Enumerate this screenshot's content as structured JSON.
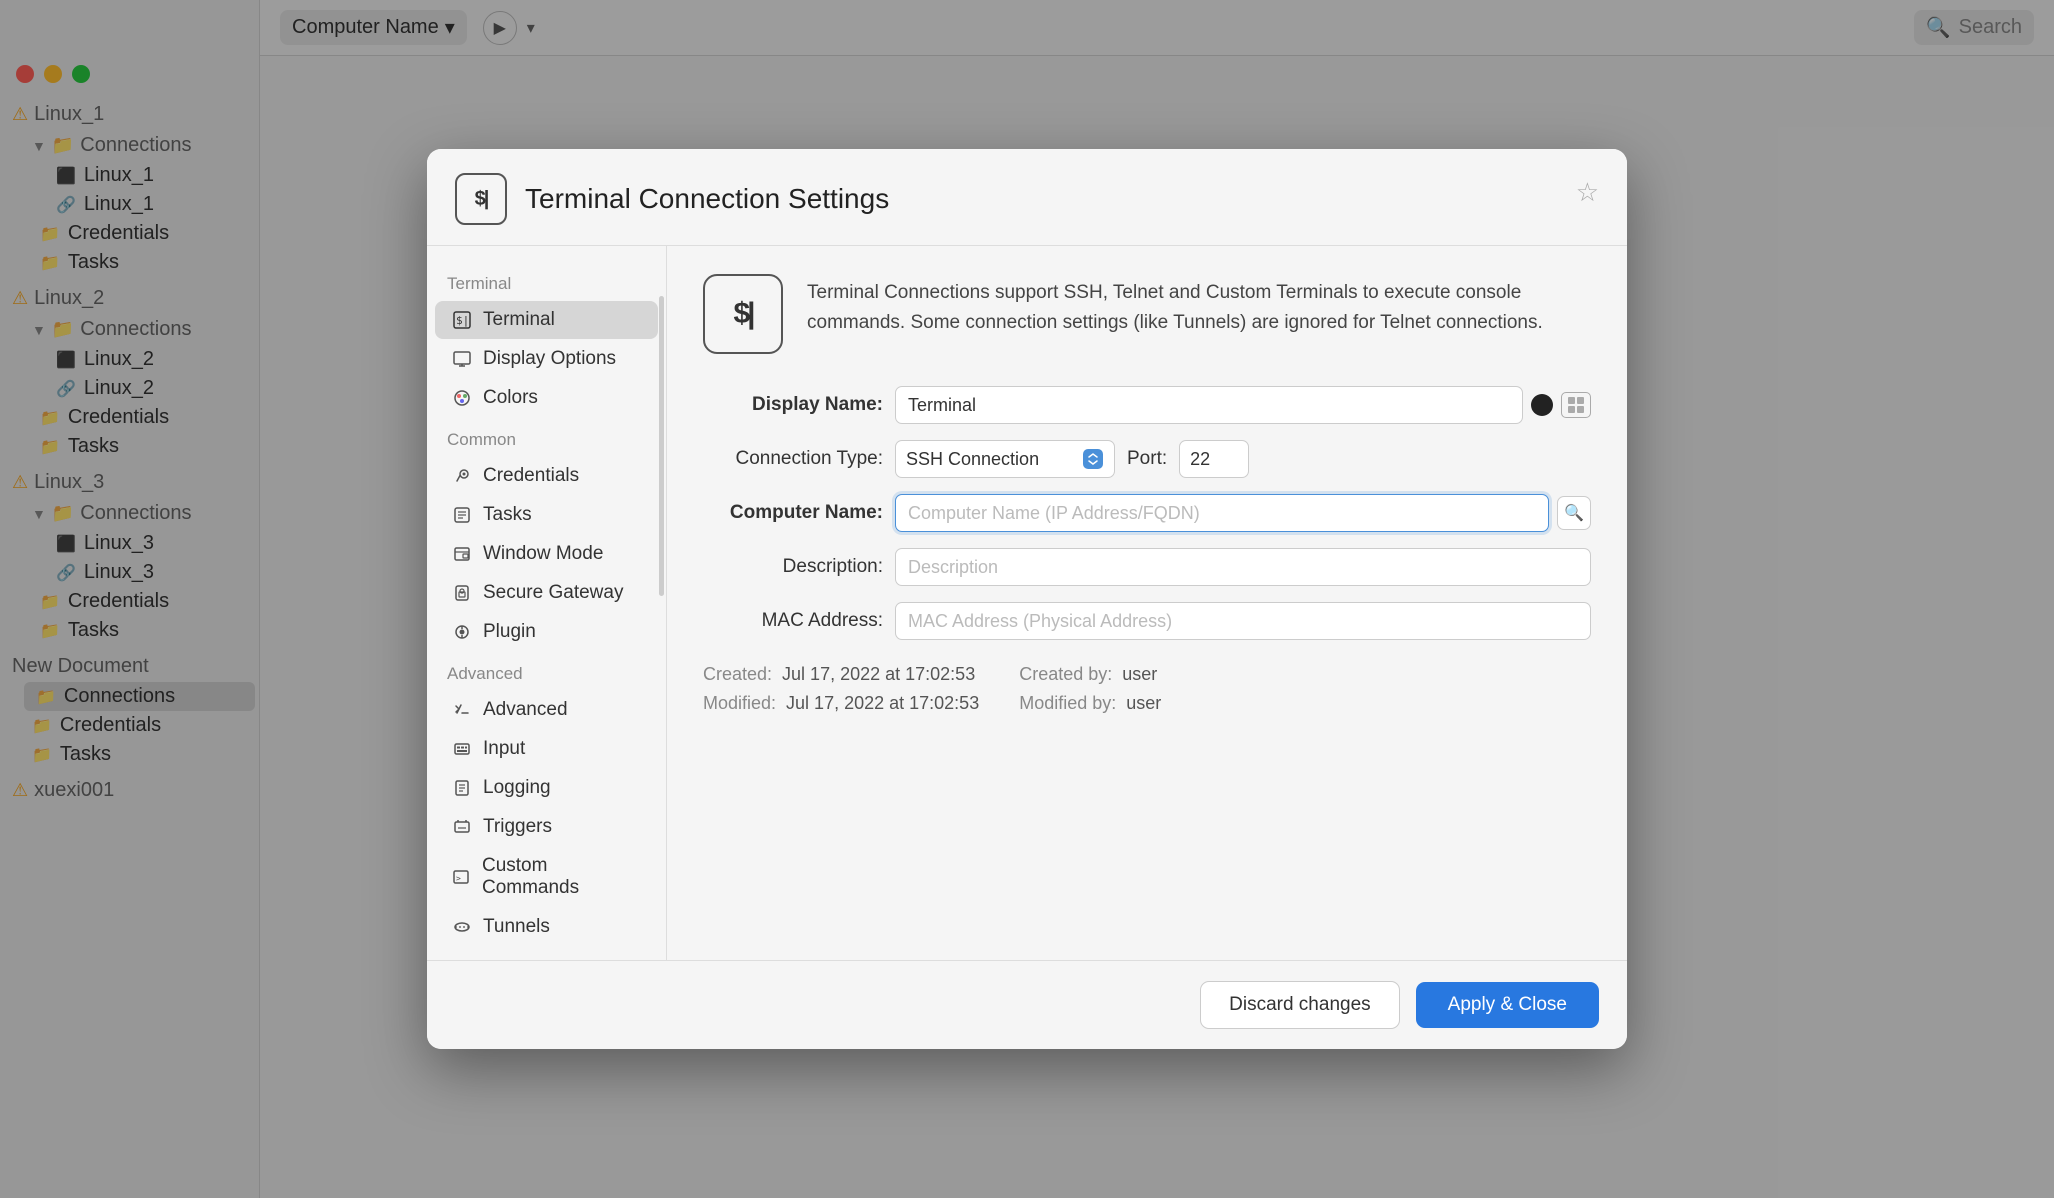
{
  "window": {
    "title": "Terminal Connection Settings",
    "star_icon": "☆"
  },
  "toolbar": {
    "computer_name": "Computer Name",
    "dropdown_arrow": "▾",
    "play_label": "▶",
    "play_dropdown": "▾",
    "search_placeholder": "Search"
  },
  "background_sidebar": {
    "groups": [
      {
        "name": "Linux_1",
        "warning": true,
        "items": [
          "Linux_1",
          "Linux_1",
          "Credentials",
          "Tasks"
        ]
      },
      {
        "name": "Linux_2",
        "warning": true,
        "items": [
          "Linux_2",
          "Linux_2",
          "Credentials",
          "Tasks"
        ]
      },
      {
        "name": "Linux_3",
        "warning": true,
        "items": [
          "Linux_3",
          "Linux_3",
          "Credentials",
          "Tasks"
        ]
      },
      {
        "name": "New Document",
        "warning": false,
        "items": [
          "Connections",
          "Credentials",
          "Tasks"
        ]
      },
      {
        "name": "xuexi001",
        "warning": true,
        "items": []
      }
    ]
  },
  "modal": {
    "header_icon": "$|",
    "title": "Terminal Connection Settings",
    "star": "☆",
    "sidebar": {
      "sections": [
        {
          "label": "Terminal",
          "items": [
            {
              "id": "terminal",
              "label": "Terminal",
              "icon": "terminal",
              "active": true
            },
            {
              "id": "display-options",
              "label": "Display Options",
              "icon": "display"
            },
            {
              "id": "colors",
              "label": "Colors",
              "icon": "palette"
            }
          ]
        },
        {
          "label": "Common",
          "items": [
            {
              "id": "credentials",
              "label": "Credentials",
              "icon": "key"
            },
            {
              "id": "tasks",
              "label": "Tasks",
              "icon": "tasks"
            },
            {
              "id": "window-mode",
              "label": "Window Mode",
              "icon": "window"
            },
            {
              "id": "secure-gateway",
              "label": "Secure Gateway",
              "icon": "shield"
            },
            {
              "id": "plugin",
              "label": "Plugin",
              "icon": "plugin"
            }
          ]
        },
        {
          "label": "Advanced",
          "items": [
            {
              "id": "advanced",
              "label": "Advanced",
              "icon": "scissors"
            },
            {
              "id": "input",
              "label": "Input",
              "icon": "keyboard"
            },
            {
              "id": "logging",
              "label": "Logging",
              "icon": "log"
            },
            {
              "id": "triggers",
              "label": "Triggers",
              "icon": "trigger"
            },
            {
              "id": "custom-commands",
              "label": "Custom Commands",
              "icon": "cmd"
            },
            {
              "id": "tunnels",
              "label": "Tunnels",
              "icon": "tunnel"
            }
          ]
        }
      ]
    },
    "content": {
      "info_icon": "$|",
      "info_text": "Terminal Connections support SSH, Telnet and Custom Terminals to execute console commands. Some connection settings (like Tunnels) are ignored for Telnet connections.",
      "form": {
        "display_name_label": "Display Name:",
        "display_name_value": "Terminal",
        "connection_type_label": "Connection Type:",
        "connection_type_value": "SSH Connection",
        "port_label": "Port:",
        "port_value": "22",
        "computer_name_label": "Computer Name:",
        "computer_name_placeholder": "Computer Name (IP Address/FQDN)",
        "description_label": "Description:",
        "description_placeholder": "Description",
        "mac_address_label": "MAC Address:",
        "mac_address_placeholder": "MAC Address (Physical Address)"
      },
      "metadata": {
        "created_label": "Created:",
        "created_value": "Jul 17, 2022 at 17:02:53",
        "created_by_label": "Created by:",
        "created_by_value": "user",
        "modified_label": "Modified:",
        "modified_value": "Jul 17, 2022 at 17:02:53",
        "modified_by_label": "Modified by:",
        "modified_by_value": "user"
      }
    },
    "footer": {
      "discard_label": "Discard changes",
      "apply_label": "Apply & Close"
    }
  },
  "colors": {
    "accent_blue": "#2878e0",
    "active_sidebar_bg": "#d6d6d6"
  },
  "icons": {
    "terminal": "⌨",
    "display": "🖥",
    "palette": "🎨",
    "key": "🔑",
    "tasks": "📋",
    "window": "🪟",
    "shield": "🛡",
    "plugin": "🔌",
    "scissors": "✂",
    "keyboard": "⌨",
    "log": "📄",
    "trigger": "⚡",
    "cmd": "▶",
    "tunnel": "🌐"
  }
}
